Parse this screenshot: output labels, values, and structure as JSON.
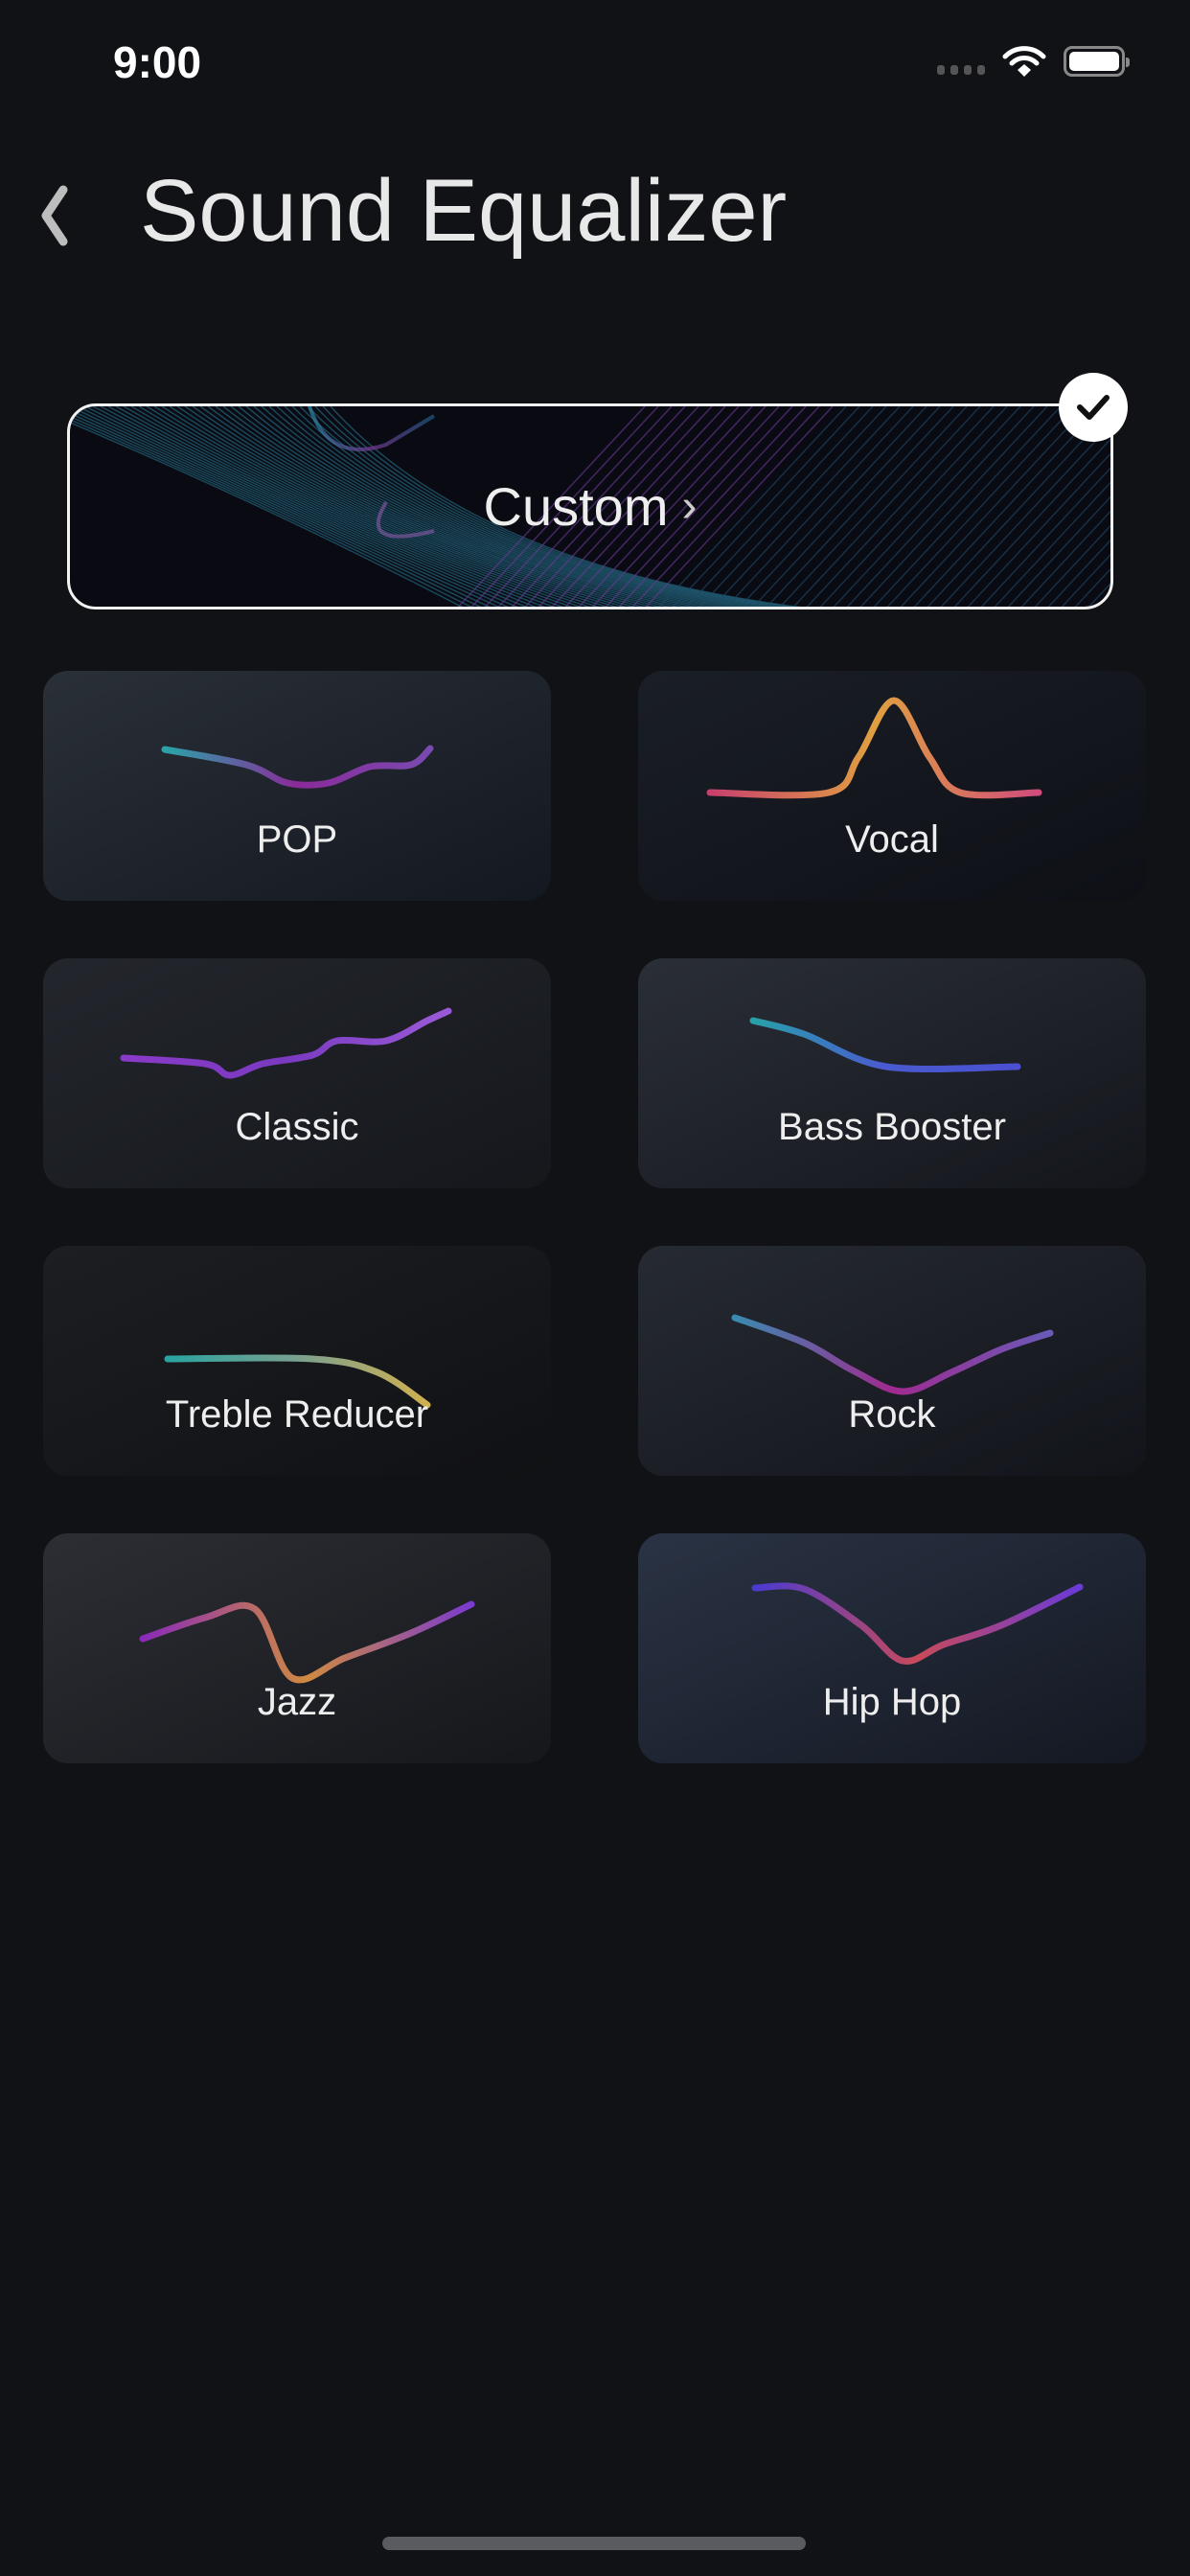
{
  "status_bar": {
    "time": "9:00",
    "icons": [
      "signal-icon",
      "wifi-icon",
      "battery-icon"
    ]
  },
  "header": {
    "title": "Sound Equalizer",
    "back_icon": "chevron-left-icon"
  },
  "custom": {
    "label": "Custom",
    "chevron": "›",
    "selected": true
  },
  "presets": [
    {
      "label": "POP",
      "colors": [
        "#2aa3a8",
        "#8a2a9a",
        "#7a4ab0"
      ],
      "bg": [
        "#2a3038",
        "#141820"
      ]
    },
    {
      "label": "Vocal",
      "colors": [
        "#c8406e",
        "#e0a040",
        "#d04c7c"
      ],
      "bg": [
        "#1a1e26",
        "#0e1016"
      ]
    },
    {
      "label": "Classic",
      "colors": [
        "#8a3ac8",
        "#7a3ac0",
        "#9a5ad8"
      ],
      "bg": [
        "#23262c",
        "#15171c"
      ]
    },
    {
      "label": "Bass Booster",
      "colors": [
        "#28a0a8",
        "#4a5ad0",
        "#4a50d0"
      ],
      "bg": [
        "#2a2e36",
        "#14161c"
      ]
    },
    {
      "label": "Treble Reducer",
      "colors": [
        "#2aa3a0",
        "#7aa090",
        "#d0b050"
      ],
      "bg": [
        "#1c1e22",
        "#101114"
      ]
    },
    {
      "label": "Rock",
      "colors": [
        "#3a8ab0",
        "#a02a90",
        "#6a5ab8"
      ],
      "bg": [
        "#262a32",
        "#12141a"
      ]
    },
    {
      "label": "Jazz",
      "colors": [
        "#8a2ab8",
        "#d08a40",
        "#7a3ad0"
      ],
      "bg": [
        "#2c2e34",
        "#16171b"
      ]
    },
    {
      "label": "Hip Hop",
      "colors": [
        "#4a3ad0",
        "#c84a5a",
        "#6a3ad8"
      ],
      "bg": [
        "#2a3344",
        "#141822"
      ]
    }
  ]
}
